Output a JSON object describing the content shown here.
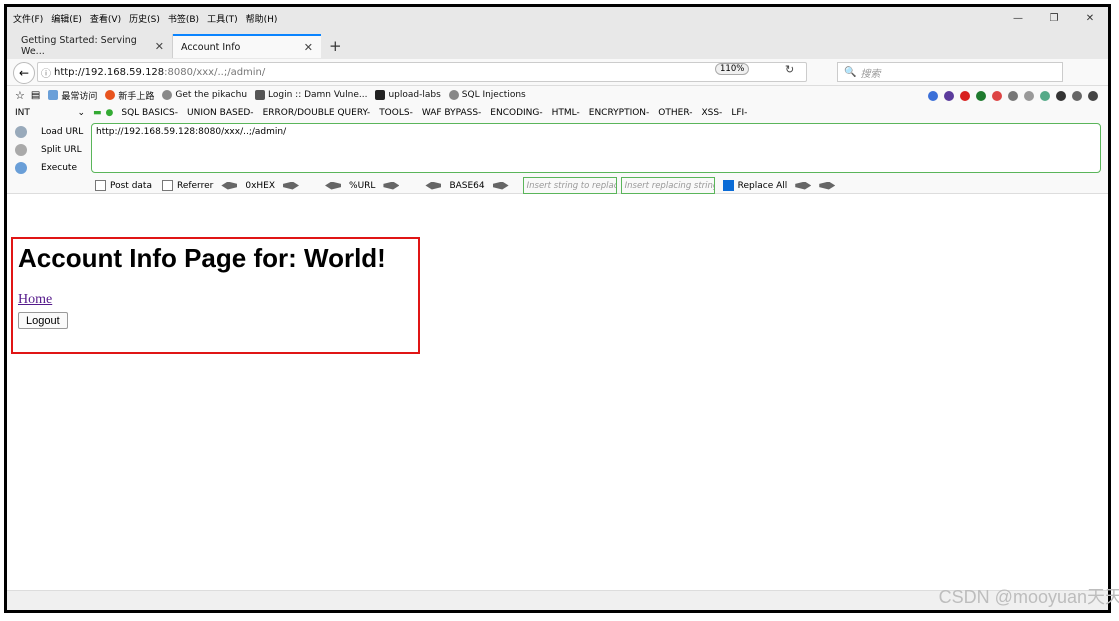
{
  "menubar": {
    "items": [
      "文件(F)",
      "编辑(E)",
      "查看(V)",
      "历史(S)",
      "书签(B)",
      "工具(T)",
      "帮助(H)"
    ]
  },
  "tabs": [
    {
      "label": "Getting Started: Serving We..."
    },
    {
      "label": "Account Info"
    }
  ],
  "navbar": {
    "url_host": "http://192.168.59.128",
    "url_rest": ":8080/xxx/..;/admin/",
    "zoom": "110%",
    "search_placeholder": "搜索"
  },
  "bookmarks": [
    "最常访问",
    "新手上路",
    "Get the pikachu",
    "Login :: Damn Vulne...",
    "upload-labs",
    "SQL Injections"
  ],
  "hackbar": {
    "select": "INT",
    "menus": [
      "SQL BASICS-",
      "UNION BASED-",
      "ERROR/DOUBLE QUERY-",
      "TOOLS-",
      "WAF BYPASS-",
      "ENCODING-",
      "HTML-",
      "ENCRYPTION-",
      "OTHER-",
      "XSS-",
      "LFI-"
    ],
    "actions": [
      "Load URL",
      "Split URL",
      "Execute"
    ],
    "url_text": "http://192.168.59.128:8080/xxx/..;/admin/",
    "post_data": "Post data",
    "referrer": "Referrer",
    "hex": "0xHEX",
    "urlenc": "%URL",
    "base64": "BASE64",
    "insert_placeholder": "Insert string to replace",
    "replacing_placeholder": "Insert replacing string",
    "replace_all": "Replace All"
  },
  "page": {
    "heading": "Account Info Page for: World!",
    "home_link": "Home",
    "logout_button": "Logout"
  },
  "watermark": "CSDN @mooyuan天天"
}
